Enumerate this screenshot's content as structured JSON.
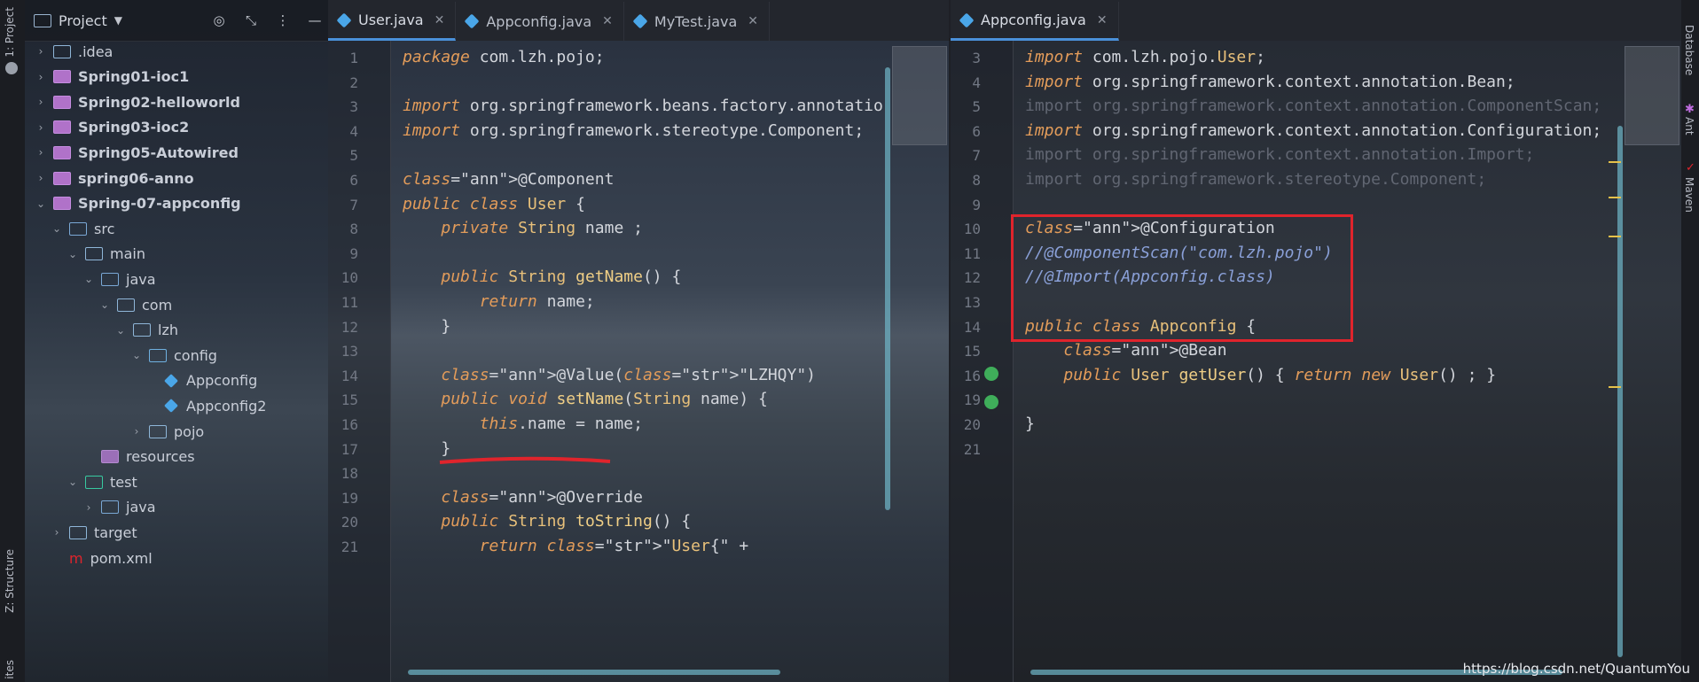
{
  "left_strip": {
    "project_label": "1: Project",
    "structure_label": "Z: Structure",
    "favorites_label": "ites"
  },
  "project_panel": {
    "title": "Project",
    "tree": [
      {
        "label": ".idea",
        "level": 1,
        "kind": "idea",
        "expanded": false
      },
      {
        "label": "Spring01-ioc1",
        "level": 1,
        "kind": "module",
        "expanded": false
      },
      {
        "label": "Spring02-helloworld",
        "level": 1,
        "kind": "module",
        "expanded": false
      },
      {
        "label": "Spring03-ioc2",
        "level": 1,
        "kind": "module",
        "expanded": false
      },
      {
        "label": "Spring05-Autowired",
        "level": 1,
        "kind": "module",
        "expanded": false
      },
      {
        "label": "spring06-anno",
        "level": 1,
        "kind": "module",
        "expanded": false
      },
      {
        "label": "Spring-07-appconfig",
        "level": 1,
        "kind": "module",
        "expanded": true
      },
      {
        "label": "src",
        "level": 2,
        "kind": "src",
        "expanded": true
      },
      {
        "label": "main",
        "level": 3,
        "kind": "folder",
        "expanded": true
      },
      {
        "label": "java",
        "level": 4,
        "kind": "src",
        "expanded": true
      },
      {
        "label": "com",
        "level": 5,
        "kind": "folder",
        "expanded": true
      },
      {
        "label": "lzh",
        "level": 6,
        "kind": "folder",
        "expanded": true
      },
      {
        "label": "config",
        "level": 7,
        "kind": "cfg",
        "expanded": true
      },
      {
        "label": "Appconfig",
        "level": 8,
        "kind": "class"
      },
      {
        "label": "Appconfig2",
        "level": 8,
        "kind": "class"
      },
      {
        "label": "pojo",
        "level": 7,
        "kind": "folder",
        "expanded": false
      },
      {
        "label": "resources",
        "level": 4,
        "kind": "res"
      },
      {
        "label": "test",
        "level": 3,
        "kind": "test",
        "expanded": true
      },
      {
        "label": "java",
        "level": 4,
        "kind": "src",
        "expanded": false
      },
      {
        "label": "target",
        "level": 2,
        "kind": "folder",
        "expanded": false
      },
      {
        "label": "pom.xml",
        "level": 2,
        "kind": "pom"
      }
    ]
  },
  "left_editor": {
    "tabs": [
      {
        "label": "User.java",
        "active": true
      },
      {
        "label": "Appconfig.java",
        "active": false
      },
      {
        "label": "MyTest.java",
        "active": false
      }
    ],
    "lines": [
      {
        "n": "1",
        "html": "package com.lzh.pojo;"
      },
      {
        "n": "2",
        "html": ""
      },
      {
        "n": "3",
        "html": "import org.springframework.beans.factory.annotatio"
      },
      {
        "n": "4",
        "html": "import org.springframework.stereotype.Component;"
      },
      {
        "n": "5",
        "html": ""
      },
      {
        "n": "6",
        "html": "@Component"
      },
      {
        "n": "7",
        "html": "public class User {"
      },
      {
        "n": "8",
        "html": "    private String name ;"
      },
      {
        "n": "9",
        "html": ""
      },
      {
        "n": "10",
        "html": "    public String getName() {"
      },
      {
        "n": "11",
        "html": "        return name;"
      },
      {
        "n": "12",
        "html": "    }"
      },
      {
        "n": "13",
        "html": ""
      },
      {
        "n": "14",
        "html": "    @Value(\"LZHQY\")"
      },
      {
        "n": "15",
        "html": "    public void setName(String name) {"
      },
      {
        "n": "16",
        "html": "        this.name = name;"
      },
      {
        "n": "17",
        "html": "    }"
      },
      {
        "n": "18",
        "html": ""
      },
      {
        "n": "19",
        "html": "    @Override"
      },
      {
        "n": "20",
        "html": "    public String toString() {"
      },
      {
        "n": "21",
        "html": "        return \"User{\" +"
      }
    ]
  },
  "right_editor": {
    "tabs": [
      {
        "label": "Appconfig.java",
        "active": true
      }
    ],
    "lines": [
      {
        "n": "3",
        "html": "import com.lzh.pojo.User;"
      },
      {
        "n": "4",
        "html": "import org.springframework.context.annotation.Bean;"
      },
      {
        "n": "5",
        "html": "import org.springframework.context.annotation.ComponentScan;"
      },
      {
        "n": "6",
        "html": "import org.springframework.context.annotation.Configuration;"
      },
      {
        "n": "7",
        "html": "import org.springframework.context.annotation.Import;"
      },
      {
        "n": "8",
        "html": "import org.springframework.stereotype.Component;"
      },
      {
        "n": "9",
        "html": ""
      },
      {
        "n": "10",
        "html": "@Configuration"
      },
      {
        "n": "11",
        "html": "//@ComponentScan(\"com.lzh.pojo\")"
      },
      {
        "n": "12",
        "html": "//@Import(Appconfig.class)"
      },
      {
        "n": "13",
        "html": ""
      },
      {
        "n": "14",
        "html": "public class Appconfig {"
      },
      {
        "n": "15",
        "html": "    @Bean"
      },
      {
        "n": "16",
        "html": "    public User getUser() { return new User() ; }"
      },
      {
        "n": "19",
        "html": ""
      },
      {
        "n": "20",
        "html": "}"
      },
      {
        "n": "21",
        "html": ""
      }
    ]
  },
  "right_strip": {
    "database_label": "Database",
    "ant_label": "Ant",
    "maven_label": "Maven"
  },
  "watermark": "https://blog.csdn.net/QuantumYou",
  "colors": {
    "highlight_box": "#e0242c",
    "accent": "#4a90d9"
  }
}
